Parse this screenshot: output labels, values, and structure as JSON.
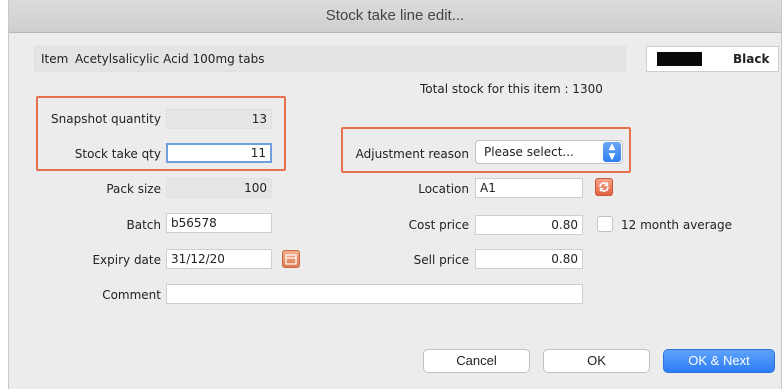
{
  "window": {
    "title": "Stock take line edit..."
  },
  "item": {
    "label": "Item",
    "value": "Acetylsalicylic Acid 100mg tabs"
  },
  "color": {
    "name": "Black",
    "swatch": "#0a0a0a"
  },
  "total_stock": {
    "text": "Total stock for this item : 1300"
  },
  "snapshot": {
    "label": "Snapshot quantity",
    "value": "13"
  },
  "stock_take": {
    "label": "Stock take qty",
    "value": "11"
  },
  "adjustment": {
    "label": "Adjustment reason",
    "selected": "Please select..."
  },
  "pack_size": {
    "label": "Pack size",
    "value": "100"
  },
  "location": {
    "label": "Location",
    "value": "A1"
  },
  "batch": {
    "label": "Batch",
    "value": "b56578"
  },
  "cost_price": {
    "label": "Cost price",
    "value": "0.80"
  },
  "twelve_month": {
    "label": "12 month average"
  },
  "expiry": {
    "label": "Expiry date",
    "value": "31/12/20"
  },
  "sell_price": {
    "label": "Sell price",
    "value": "0.80"
  },
  "comment": {
    "label": "Comment",
    "value": ""
  },
  "buttons": {
    "cancel": "Cancel",
    "ok": "OK",
    "ok_next": "OK & Next"
  },
  "colors": {
    "highlight": "#e5704b",
    "accent": "#2c7cf4"
  },
  "icons": {
    "location_action": "refresh-icon",
    "expiry_picker": "calendar-icon",
    "select_arrow": "updown-chevron-icon"
  }
}
